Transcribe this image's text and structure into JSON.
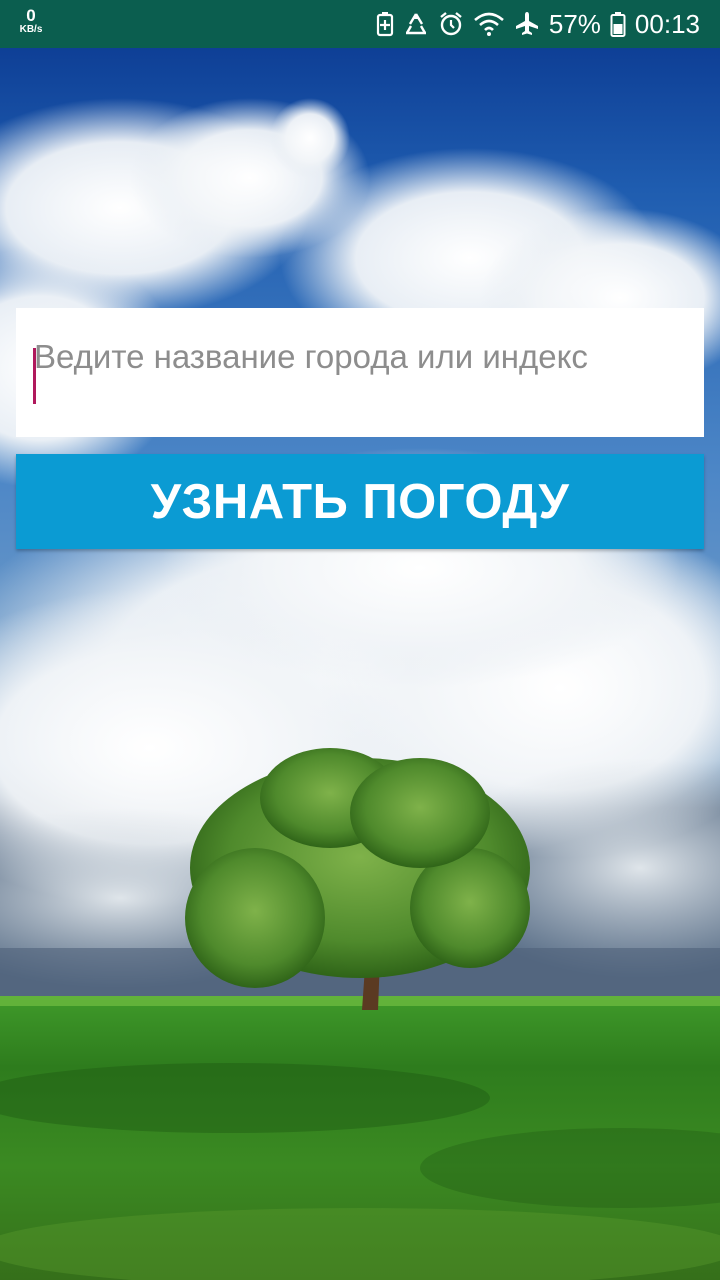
{
  "status_bar": {
    "net_speed_value": "0",
    "net_speed_unit": "KB/s",
    "battery_percent": "57%",
    "time": "00:13",
    "icons": [
      "battery-saver-icon",
      "recycle-icon",
      "alarm-icon",
      "wifi-icon",
      "airplane-mode-icon",
      "battery-icon"
    ],
    "background_color": "#0b5e4f"
  },
  "search": {
    "placeholder": "Ведите название города или индекс",
    "value": ""
  },
  "weather_button": {
    "label": "УЗНАТЬ ПОГОДУ",
    "color": "#0b9bd3"
  },
  "background": {
    "description_icon": "sky-tree-field-image"
  }
}
